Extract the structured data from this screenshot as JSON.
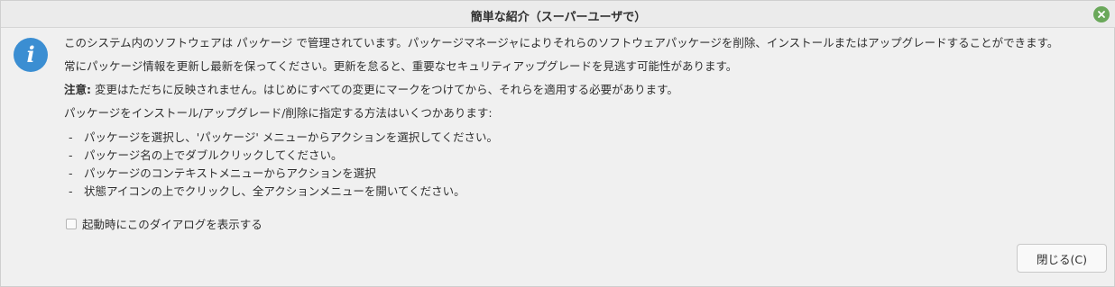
{
  "window": {
    "title": "簡単な紹介（スーパーユーザで）"
  },
  "icons": {
    "info": "info-icon",
    "close": "close-icon"
  },
  "colors": {
    "info_blue": "#3b8ed2",
    "close_green": "#6aa85a"
  },
  "content": {
    "p1": "このシステム内のソフトウェアは パッケージ で管理されています。パッケージマネージャによりそれらのソフトウェアパッケージを削除、インストールまたはアップグレードすることができます。",
    "p2": "常にパッケージ情報を更新し最新を保ってください。更新を怠ると、重要なセキュリティアップグレードを見逃す可能性があります。",
    "note_label": "注意:",
    "note_text": " 変更はただちに反映されません。はじめにすべての変更にマークをつけてから、それらを適用する必要があります。",
    "methods_intro": "パッケージをインストール/アップグレード/削除に指定する方法はいくつかあります:",
    "bullets": [
      {
        "dash": "-",
        "text": "パッケージを選択し、'パッケージ' メニューからアクションを選択してください。"
      },
      {
        "dash": "-",
        "text": "パッケージ名の上でダブルクリックしてください。"
      },
      {
        "dash": "-",
        "text": "パッケージのコンテキストメニューからアクションを選択"
      },
      {
        "dash": "-",
        "text": "状態アイコンの上でクリックし、全アクションメニューを開いてください。"
      }
    ]
  },
  "checkbox": {
    "label": "起動時にこのダイアログを表示する",
    "checked": false
  },
  "buttons": {
    "close_label": "閉じる(C)"
  }
}
